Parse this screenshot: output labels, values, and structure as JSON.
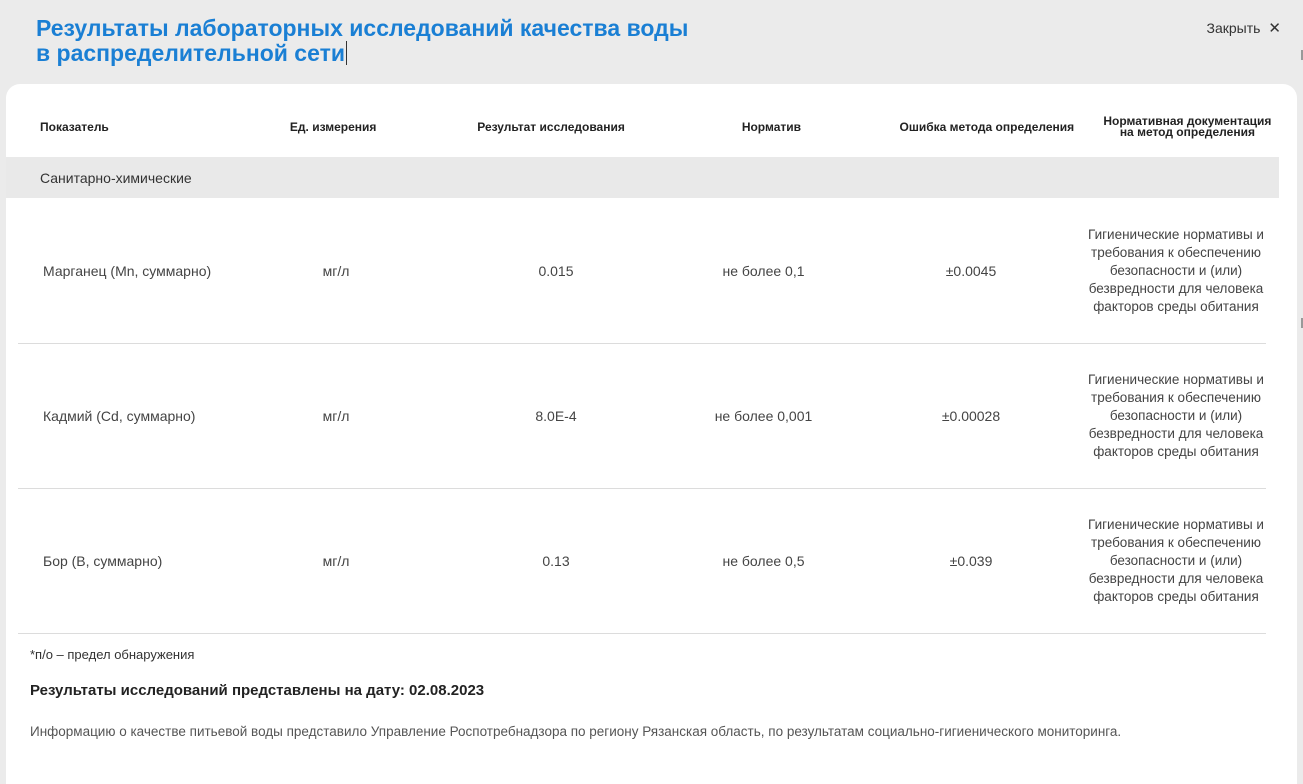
{
  "modal": {
    "title_line1": "Результаты лабораторных исследований качества воды",
    "title_line2": "в распределительной сети",
    "close_label": "Закрыть",
    "close_icon": "close-icon"
  },
  "table": {
    "headers": [
      "Показатель",
      "Ед. измерения",
      "Результат исследования",
      "Норматив",
      "Ошибка метода определения",
      "Нормативная документация на метод определения"
    ],
    "group": "Санитарно-химические",
    "rows": [
      {
        "indicator": "Марганец (Mn, суммарно)",
        "unit": "мг/л",
        "result": "0.015",
        "norm": "не более 0,1",
        "error": "±0.0045",
        "doc": "Гигиенические нормативы и требования к обеспечению безопасности и (или) безвредности для человека факторов среды обитания"
      },
      {
        "indicator": "Кадмий (Cd, суммарно)",
        "unit": "мг/л",
        "result": "8.0E-4",
        "norm": "не более 0,001",
        "error": "±0.00028",
        "doc": "Гигиенические нормативы и требования к обеспечению безопасности и (или) безвредности для человека факторов среды обитания"
      },
      {
        "indicator": "Бор (B, суммарно)",
        "unit": "мг/л",
        "result": "0.13",
        "norm": "не более 0,5",
        "error": "±0.039",
        "doc": "Гигиенические нормативы и требования к обеспечению безопасности и (или) безвредности для человека факторов среды обитания"
      }
    ]
  },
  "footnote": "*п/о – предел обнаружения",
  "date_line": "Результаты исследований представлены на дату: 02.08.2023",
  "info": "Информацию о качестве питьевой воды представило Управление Роспотребнадзора по региону Рязанская область, по результатам социально-гигиенического мониторинга.",
  "colors": {
    "title": "#1a7fd4",
    "background": "#ebebeb",
    "group_row": "#e9e9e9"
  }
}
